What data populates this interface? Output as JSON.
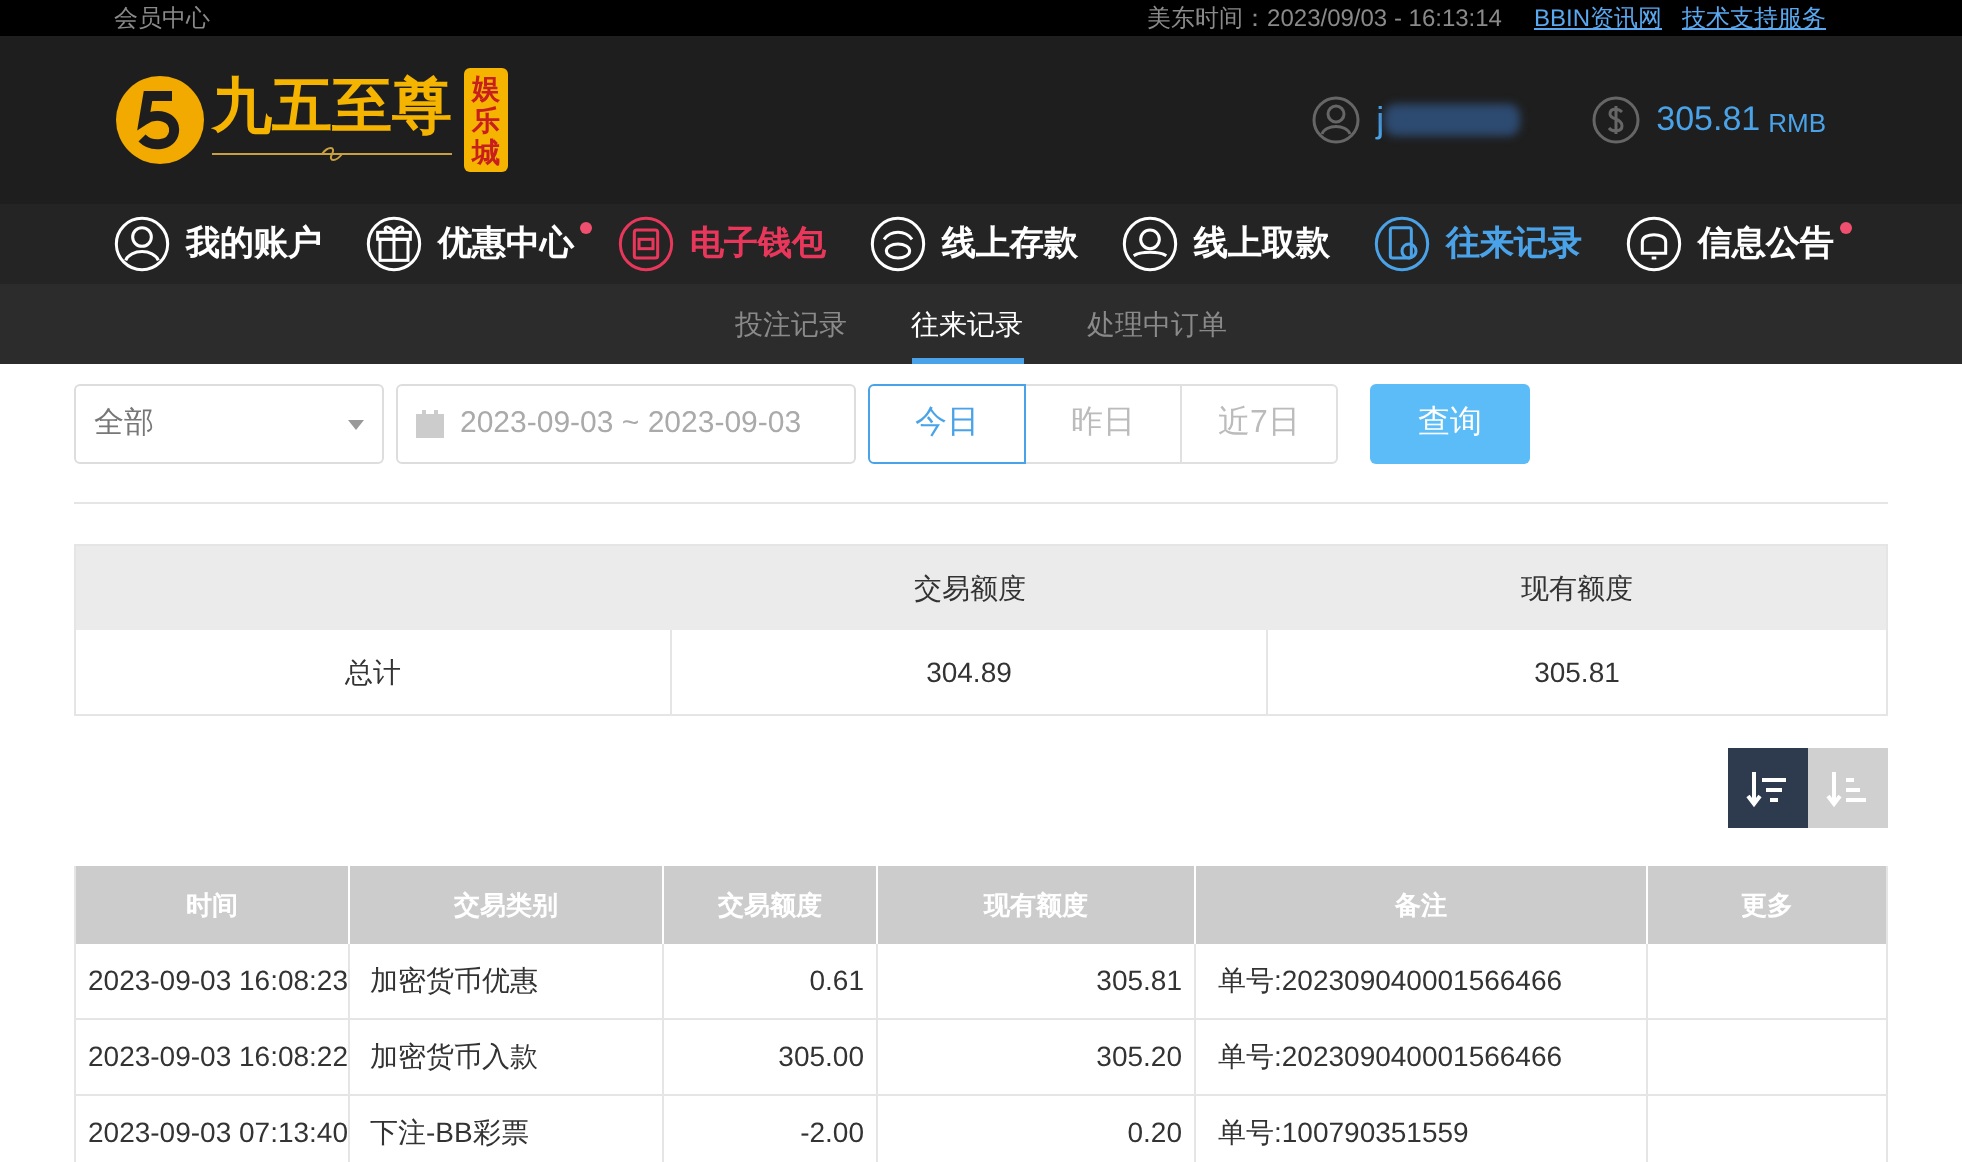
{
  "top_bar": {
    "title": "会员中心",
    "time_label": "美东时间：2023/09/03 - 16:13:14",
    "links": [
      "BBIN资讯网",
      "技术支持服务"
    ]
  },
  "header": {
    "logo_text": "九五至尊",
    "logo_badge": "娱乐城",
    "username": "j",
    "balance": "305.81",
    "currency": "RMB"
  },
  "nav": [
    {
      "label": "我的账户",
      "color": "#ffffff",
      "badge": false
    },
    {
      "label": "优惠中心",
      "color": "#ffffff",
      "badge": true
    },
    {
      "label": "电子钱包",
      "color": "#e8375a",
      "badge": false
    },
    {
      "label": "线上存款",
      "color": "#ffffff",
      "badge": false
    },
    {
      "label": "线上取款",
      "color": "#ffffff",
      "badge": false
    },
    {
      "label": "往来记录",
      "color": "#4aa3e8",
      "badge": false
    },
    {
      "label": "信息公告",
      "color": "#ffffff",
      "badge": true
    }
  ],
  "sub_tabs": [
    {
      "label": "投注记录",
      "selected": false
    },
    {
      "label": "往来记录",
      "selected": true
    },
    {
      "label": "处理中订单",
      "selected": false
    }
  ],
  "filters": {
    "type_select": "全部",
    "date_range": "2023-09-03 ~ 2023-09-03",
    "quick": [
      {
        "label": "今日",
        "selected": true
      },
      {
        "label": "昨日",
        "selected": false
      },
      {
        "label": "近7日",
        "selected": false
      }
    ],
    "query_button": "查询"
  },
  "summary": {
    "columns": [
      "交易额度",
      "现有额度"
    ],
    "rows": [
      {
        "label": "总计",
        "cells": [
          "304.89",
          "305.81"
        ]
      }
    ]
  },
  "sort_buttons": [
    {
      "selected": true
    },
    {
      "selected": false
    }
  ],
  "table": {
    "columns": [
      "时间",
      "交易类别",
      "交易额度",
      "现有额度",
      "备注",
      "更多"
    ],
    "rows": [
      [
        "2023-09-03 16:08:23",
        "加密货币优惠",
        "0.61",
        "305.81",
        "单号:202309040001566466"
      ],
      [
        "2023-09-03 16:08:22",
        "加密货币入款",
        "305.00",
        "305.20",
        "单号:202309040001566466"
      ],
      [
        "2023-09-03 07:13:40",
        "下注-BB彩票",
        "-2.00",
        "0.20",
        "单号:100790351559"
      ]
    ]
  }
}
